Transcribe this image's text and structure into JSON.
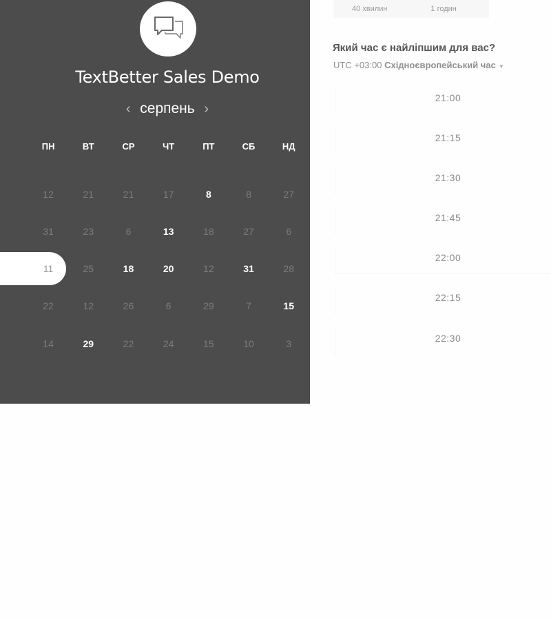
{
  "calendar": {
    "title": "TextBetter Sales Demo",
    "month": "серпень",
    "prev_icon": "chevron-left-icon",
    "next_icon": "chevron-right-icon",
    "logo_icon": "chat-bubbles-icon",
    "weekdays": [
      "ПН",
      "ВТ",
      "СР",
      "ЧТ",
      "ПТ",
      "СБ",
      "НД"
    ],
    "rows": [
      [
        {
          "d": "12",
          "a": false
        },
        {
          "d": "21",
          "a": false
        },
        {
          "d": "21",
          "a": false
        },
        {
          "d": "17",
          "a": false
        },
        {
          "d": "8",
          "a": true
        },
        {
          "d": "8",
          "a": false
        },
        {
          "d": "27",
          "a": false
        }
      ],
      [
        {
          "d": "31",
          "a": false
        },
        {
          "d": "23",
          "a": false
        },
        {
          "d": "6",
          "a": false
        },
        {
          "d": "13",
          "a": true
        },
        {
          "d": "18",
          "a": false
        },
        {
          "d": "27",
          "a": false
        },
        {
          "d": "6",
          "a": false
        }
      ],
      [
        {
          "d": "11",
          "a": false,
          "selected": true
        },
        {
          "d": "25",
          "a": false
        },
        {
          "d": "18",
          "a": true
        },
        {
          "d": "20",
          "a": true
        },
        {
          "d": "12",
          "a": false
        },
        {
          "d": "31",
          "a": true
        },
        {
          "d": "28",
          "a": false
        }
      ],
      [
        {
          "d": "22",
          "a": false
        },
        {
          "d": "12",
          "a": false
        },
        {
          "d": "26",
          "a": false
        },
        {
          "d": "6",
          "a": false
        },
        {
          "d": "29",
          "a": false
        },
        {
          "d": "7",
          "a": false
        },
        {
          "d": "15",
          "a": true
        }
      ],
      [
        {
          "d": "14",
          "a": false
        },
        {
          "d": "29",
          "a": true
        },
        {
          "d": "22",
          "a": false
        },
        {
          "d": "24",
          "a": false
        },
        {
          "d": "15",
          "a": false
        },
        {
          "d": "10",
          "a": false
        },
        {
          "d": "3",
          "a": false
        }
      ]
    ]
  },
  "durations": [
    "40 хвилин",
    "1 годин"
  ],
  "schedule": {
    "question": "Який час є найліпшим для вас?",
    "tz_offset": "UTC +03:00",
    "tz_name": "Східноєвропейський час",
    "tz_caret_icon": "caret-down-icon",
    "slots": [
      "21:00",
      "21:15",
      "21:30",
      "21:45",
      "22:00",
      "22:15",
      "22:30"
    ]
  },
  "colors": {
    "panel_bg": "#4c4c4c",
    "available_day": "#ffffff",
    "unavailable_day": "#7c7c7c"
  }
}
